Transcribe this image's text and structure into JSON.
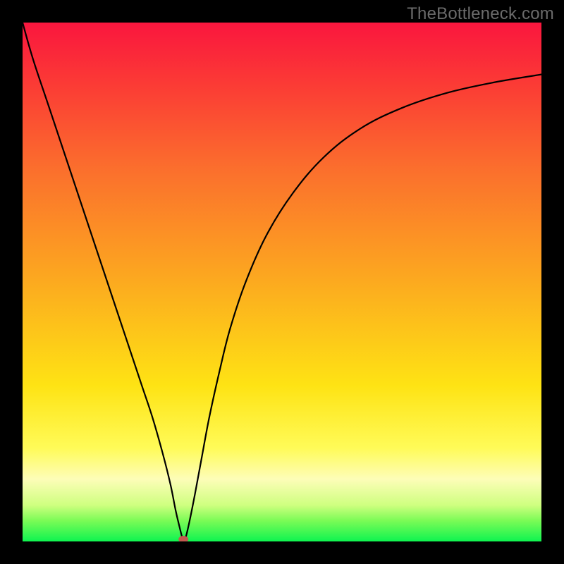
{
  "watermark": "TheBottleneck.com",
  "chart_data": {
    "type": "line",
    "title": "",
    "xlabel": "",
    "ylabel": "",
    "xlim": [
      0,
      100
    ],
    "ylim": [
      0,
      100
    ],
    "series": [
      {
        "name": "bottleneck-curve",
        "x": [
          0,
          2,
          5,
          8,
          11,
          14,
          17,
          20,
          23,
          25,
          27,
          28.5,
          29.5,
          30.2,
          30.7,
          31.0,
          31.5,
          32.2,
          33.2,
          34.5,
          36,
          38,
          40,
          43,
          47,
          52,
          58,
          65,
          73,
          82,
          91,
          100
        ],
        "y": [
          100,
          93,
          84,
          75,
          66,
          57,
          48,
          39,
          30,
          24,
          17,
          11,
          6,
          3,
          1,
          0,
          1,
          4,
          9,
          16,
          24,
          33,
          41,
          50,
          59,
          67,
          74,
          79.5,
          83.5,
          86.5,
          88.5,
          90
        ]
      }
    ],
    "marker": {
      "name": "optimal-point",
      "x": 31.0,
      "y": 0,
      "color": "#c25a4f",
      "rx": 7,
      "ry": 5
    },
    "background_gradient": {
      "orientation": "vertical",
      "stops": [
        {
          "pos": 0.0,
          "color": "#fa163e"
        },
        {
          "pos": 0.28,
          "color": "#fb6e2d"
        },
        {
          "pos": 0.5,
          "color": "#fcaa1f"
        },
        {
          "pos": 0.7,
          "color": "#fee314"
        },
        {
          "pos": 0.88,
          "color": "#fdfdb8"
        },
        {
          "pos": 0.96,
          "color": "#7bfb56"
        },
        {
          "pos": 1.0,
          "color": "#0ef450"
        }
      ]
    }
  }
}
